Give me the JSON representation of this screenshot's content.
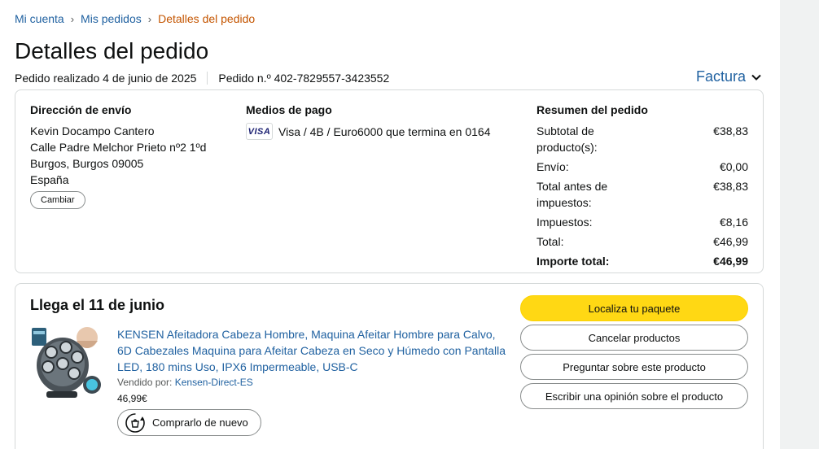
{
  "breadcrumb": {
    "items": [
      "Mi cuenta",
      "Mis pedidos"
    ],
    "separator": "›",
    "current": "Detalles del pedido"
  },
  "page": {
    "title": "Detalles del pedido",
    "order_date": "Pedido realizado 4 de junio de 2025",
    "order_number": "Pedido n.º 402-7829557-3423552",
    "invoice_label": "Factura"
  },
  "shipping": {
    "title": "Dirección de envío",
    "name": "Kevin Docampo Cantero",
    "street": "Calle Padre Melchor Prieto nº2 1ºd",
    "city": "Burgos, Burgos 09005",
    "country": "España",
    "change_label": "Cambiar"
  },
  "payment": {
    "title": "Medios de pago",
    "card_brand": "VISA",
    "description": "Visa / 4B / Euro6000  que termina en 0164"
  },
  "summary": {
    "title": "Resumen del pedido",
    "rows": [
      {
        "label": "Subtotal de producto(s):",
        "value": "€38,83"
      },
      {
        "label": "Envío:",
        "value": "€0,00"
      },
      {
        "label": "Total antes de impuestos:",
        "value": "€38,83"
      },
      {
        "label": "Impuestos:",
        "value": "€8,16"
      },
      {
        "label": "Total:",
        "value": "€46,99"
      }
    ],
    "grand_total_label": "Importe total:",
    "grand_total_value": "€46,99"
  },
  "shipment": {
    "arrival": "Llega el 11 de junio",
    "product_title": "KENSEN Afeitadora Cabeza Hombre, Maquina Afeitar Hombre para Calvo, 6D Cabezales Maquina para Afeitar Cabeza en Seco y Húmedo con Pantalla LED, 180 mins Uso, IPX6 Impermeable, USB-C",
    "sold_by_label": "Vendido por:",
    "seller": "Kensen-Direct-ES",
    "price": "46,99€",
    "rebuy_label": "Comprarlo de nuevo",
    "actions": {
      "track": "Localiza tu paquete",
      "cancel": "Cancelar productos",
      "question": "Preguntar sobre este producto",
      "review": "Escribir una opinión sobre el producto"
    }
  },
  "colors": {
    "link": "#2162a1",
    "breadcrumb_current": "#c45500",
    "primary_button": "#ffd814",
    "border": "#d5d9d9"
  }
}
